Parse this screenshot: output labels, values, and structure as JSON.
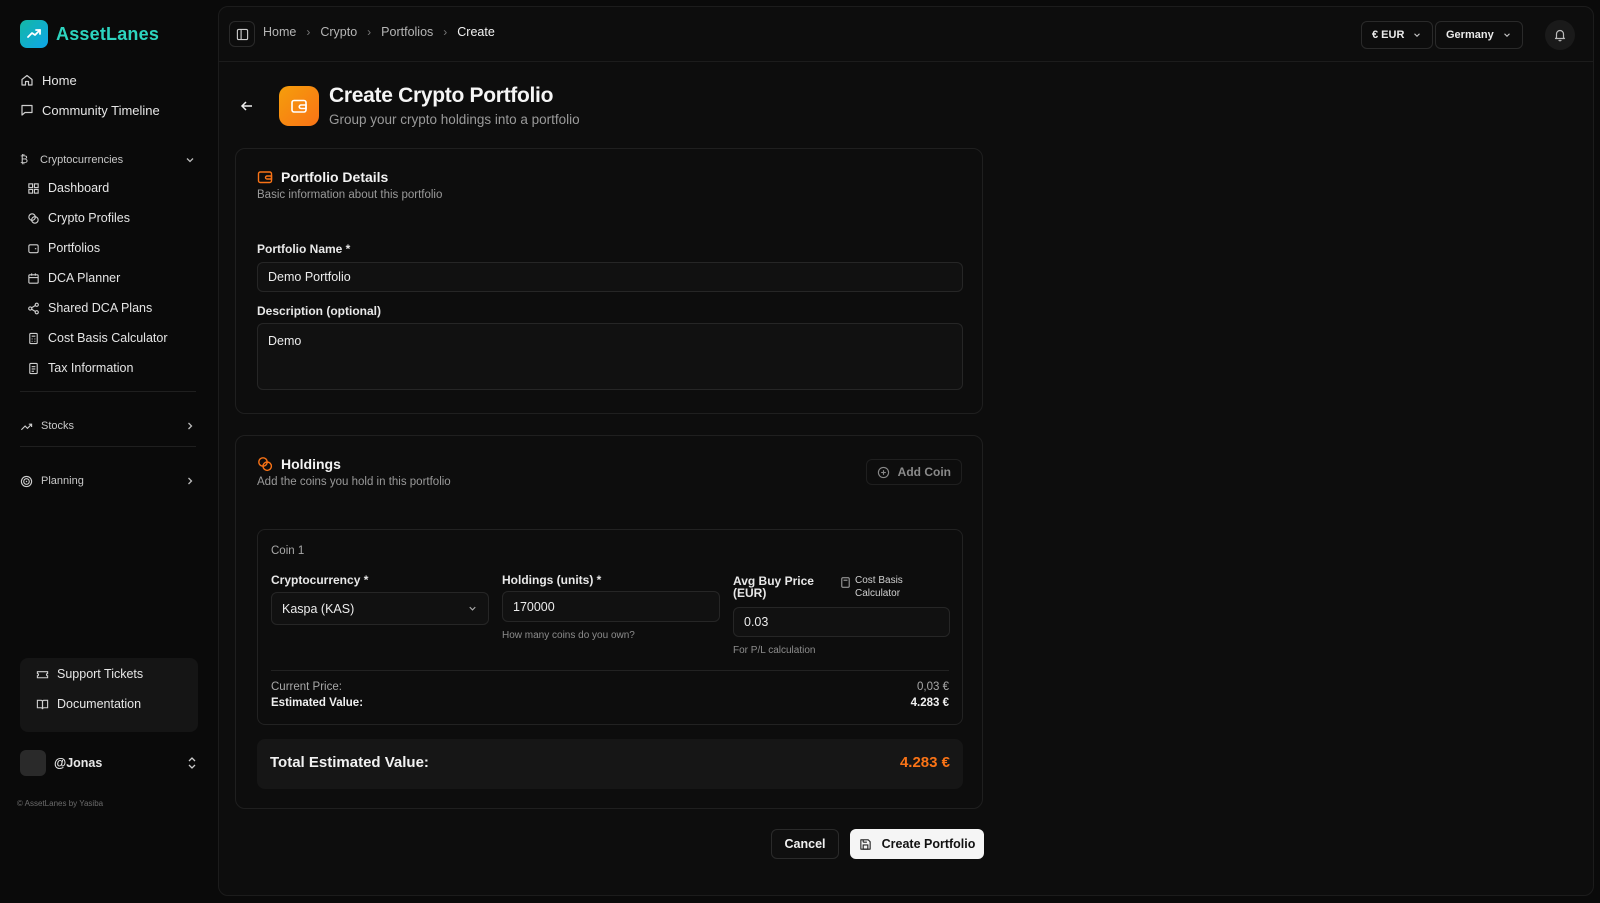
{
  "app": {
    "name": "AssetLanes"
  },
  "sidebar": {
    "top_items": [
      {
        "label": "Home",
        "icon": "home-icon"
      },
      {
        "label": "Community Timeline",
        "icon": "message-icon"
      }
    ],
    "crypto_group": {
      "label": "Cryptocurrencies",
      "expanded": true,
      "items": [
        {
          "label": "Dashboard",
          "icon": "grid-icon"
        },
        {
          "label": "Crypto Profiles",
          "icon": "coins-icon"
        },
        {
          "label": "Portfolios",
          "icon": "wallet-icon"
        },
        {
          "label": "DCA Planner",
          "icon": "calendar-icon"
        },
        {
          "label": "Shared DCA Plans",
          "icon": "share-icon"
        },
        {
          "label": "Cost Basis Calculator",
          "icon": "calculator-icon"
        },
        {
          "label": "Tax Information",
          "icon": "receipt-icon"
        }
      ]
    },
    "stocks_group": {
      "label": "Stocks",
      "expanded": false
    },
    "planning_group": {
      "label": "Planning",
      "expanded": false
    },
    "support": [
      {
        "label": "Support Tickets",
        "icon": "ticket-icon"
      },
      {
        "label": "Documentation",
        "icon": "book-icon"
      }
    ],
    "user": {
      "handle": "@Jonas"
    },
    "copyright": "© AssetLanes by Yasiba"
  },
  "topbar": {
    "breadcrumb": [
      "Home",
      "Crypto",
      "Portfolios",
      "Create"
    ],
    "currency": "€ EUR",
    "country": "Germany"
  },
  "page": {
    "title": "Create Crypto Portfolio",
    "subtitle": "Group your crypto holdings into a portfolio"
  },
  "details": {
    "title": "Portfolio Details",
    "subtitle": "Basic information about this portfolio",
    "name_label": "Portfolio Name *",
    "name_value": "Demo Portfolio",
    "desc_label": "Description (optional)",
    "desc_value": "Demo"
  },
  "holdings": {
    "title": "Holdings",
    "subtitle": "Add the coins you hold in this portfolio",
    "add_coin_label": "Add Coin",
    "coins": [
      {
        "title": "Coin 1",
        "crypto_label": "Cryptocurrency *",
        "crypto_value": "Kaspa (KAS)",
        "units_label": "Holdings (units) *",
        "units_value": "170000",
        "units_hint": "How many coins do you own?",
        "avg_label": "Avg Buy Price (EUR)",
        "cost_basis_label": "Cost Basis Calculator",
        "avg_value": "0.03",
        "avg_hint": "For P/L calculation",
        "current_price_label": "Current Price:",
        "current_price_value": "0,03 €",
        "estimated_label": "Estimated Value:",
        "estimated_value": "4.283 €"
      }
    ],
    "total_label": "Total Estimated Value:",
    "total_value": "4.283 €"
  },
  "actions": {
    "cancel": "Cancel",
    "create": "Create Portfolio"
  },
  "colors": {
    "accent_orange": "#f97316",
    "brand_teal": "#2dd4bf",
    "background": "#0a0a0a"
  }
}
